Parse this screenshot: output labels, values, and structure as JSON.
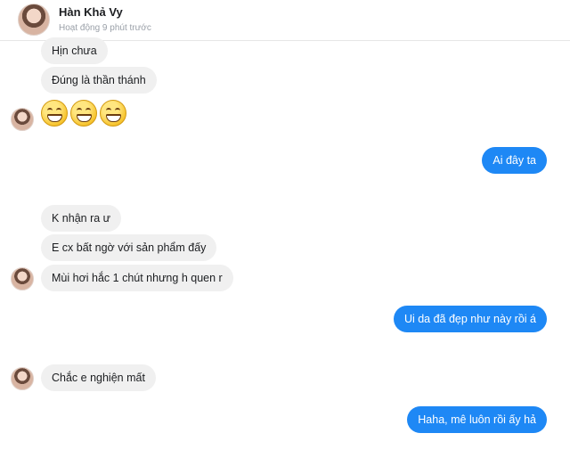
{
  "header": {
    "name": "Hàn Khả Vy",
    "status": "Hoạt động 9 phút trước"
  },
  "messages": [
    {
      "side": "in",
      "text": "Hịn chưa"
    },
    {
      "side": "in",
      "text": "Đúng là thần thánh"
    },
    {
      "side": "in",
      "type": "emoji",
      "emojis": [
        "grinning-face-icon",
        "grinning-face-icon",
        "grinning-face-icon"
      ]
    },
    {
      "side": "out",
      "text": "Ai đây ta"
    },
    {
      "side": "in",
      "text": "K nhận ra ư"
    },
    {
      "side": "in",
      "text": "E cx bất ngờ với sản phẩm đấy"
    },
    {
      "side": "in",
      "text": "Mùi hơi hắc 1 chút nhưng h quen r"
    },
    {
      "side": "out",
      "text": "Ui da đã đẹp như này rồi á"
    },
    {
      "side": "in",
      "text": "Chắc e nghiện mất"
    },
    {
      "side": "out",
      "text": "Haha, mê luôn rồi ấy hả"
    }
  ],
  "colors": {
    "outgoing_bubble": "#1e88f5",
    "incoming_bubble": "#f0f0f0",
    "status_text": "#9aa0a8"
  }
}
